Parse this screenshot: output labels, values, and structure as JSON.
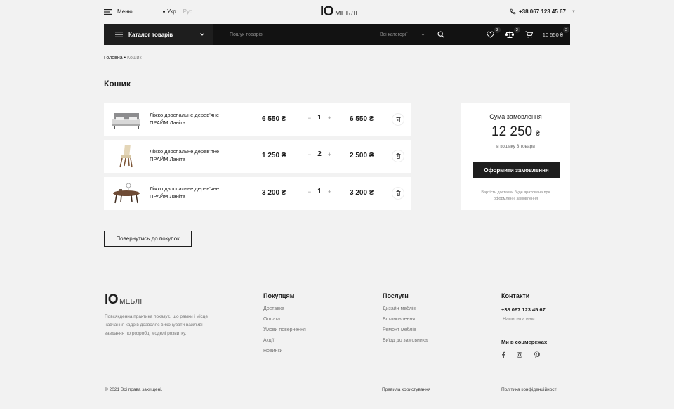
{
  "header": {
    "menu_label": "Меню",
    "lang_active": "Укр",
    "lang_inactive": "Рус",
    "logo_mark": "IO",
    "logo_word": "МЕБЛІ",
    "phone": "+38 067 123 45 67"
  },
  "nav": {
    "catalog_label": "Каталог товарів",
    "search_placeholder": "Пошук товарів",
    "category_select": "Всі категорії",
    "wishlist_count": "3",
    "compare_count": "2",
    "cart_count": "2",
    "cart_total": "10 550 ₴"
  },
  "breadcrumb": {
    "home": "Головна",
    "current": "Кошик"
  },
  "page_title": "Кошик",
  "cart_items": [
    {
      "name": "Ліжко двоспальне дерев'яне ПРАЙМ Ланіта",
      "price": "6 550 ₴",
      "qty": "1",
      "total": "6 550 ₴",
      "image": "bed"
    },
    {
      "name": "Ліжко двоспальне дерев'яне ПРАЙМ Ланіта",
      "price": "1 250 ₴",
      "qty": "2",
      "total": "2 500 ₴",
      "image": "chair"
    },
    {
      "name": "Ліжко двоспальне дерев'яне ПРАЙМ Ланіта",
      "price": "3 200 ₴",
      "qty": "1",
      "total": "3 200 ₴",
      "image": "table"
    }
  ],
  "qty_minus": "−",
  "qty_plus": "+",
  "summary": {
    "title": "Сума замовлення",
    "amount": "12 250",
    "currency": "₴",
    "count_text": "в кошику 3 товари",
    "checkout_label": "Оформити замовлення",
    "delivery_note": "Вартість доставки буде врахована при оформленні замовлення"
  },
  "back_button": "Повернутись до покупок",
  "footer": {
    "description": "Повсякденна практика показує, що рамки і місце навчання кадрів дозволяє виконувати важливі завдання по розробці моделі розвитку.",
    "buyers": {
      "title": "Покупцям",
      "links": [
        "Доставка",
        "Оплата",
        "Умови повернення",
        "Акції",
        "Новинки"
      ]
    },
    "services": {
      "title": "Послуги",
      "links": [
        "Дизайн меблів",
        "Встановлення",
        "Ремонт меблів",
        "Виїзд до замовника"
      ]
    },
    "contacts": {
      "title": "Контакти",
      "phone": "+38 067 123 45 67",
      "write": "Написати нам"
    },
    "social_title": "Ми в соцмережах",
    "socials": [
      "facebook-icon",
      "instagram-icon",
      "pinterest-icon"
    ],
    "copyright": "© 2021 Всі права захищені.",
    "rules": "Правила користування",
    "privacy": "Політика конфіденційності"
  }
}
